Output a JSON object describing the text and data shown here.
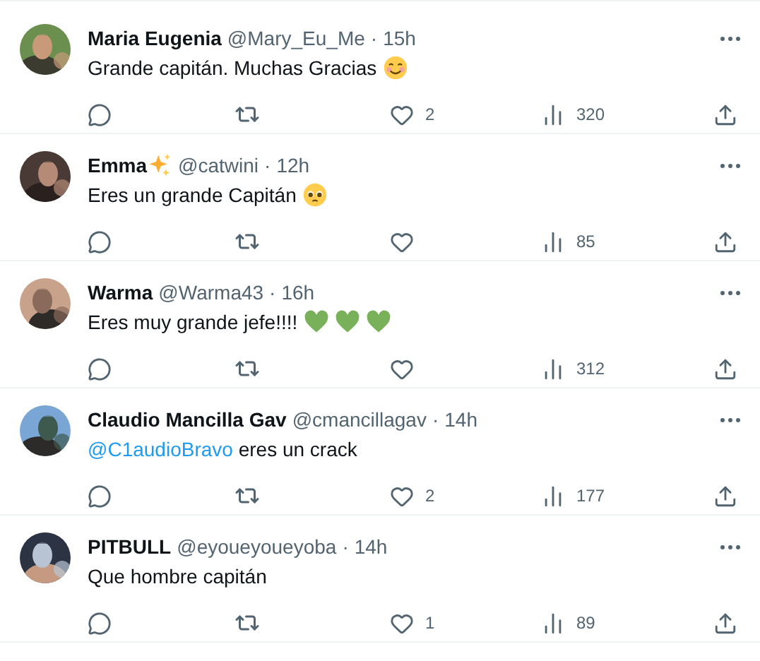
{
  "replies": [
    {
      "name": "Maria Eugenia",
      "handle": "@Mary_Eu_Me",
      "separator": "·",
      "time": "15h",
      "text": "Grande capitán. Muchas Gracias",
      "emojis": [
        {
          "kind": "smiling"
        }
      ],
      "likes": "2",
      "views": "320"
    },
    {
      "name": "Emma",
      "name_emoji": {
        "kind": "sparkles"
      },
      "handle": "@catwini",
      "separator": "·",
      "time": "12h",
      "text": "Eres un grande Capitán",
      "emojis": [
        {
          "kind": "pleading"
        }
      ],
      "views": "85"
    },
    {
      "name": "Warma",
      "handle": "@Warma43",
      "separator": "·",
      "time": "16h",
      "text": "Eres muy grande jefe!!!!",
      "emojis": [
        {
          "kind": "green-heart"
        },
        {
          "kind": "green-heart"
        },
        {
          "kind": "green-heart"
        }
      ],
      "views": "312"
    },
    {
      "name": "Claudio Mancilla Gav",
      "handle": "@cmancillagav",
      "separator": "·",
      "time": "14h",
      "mention": "@C1audioBravo",
      "text": "eres un crack",
      "likes": "2",
      "views": "177"
    },
    {
      "name": "PITBULL",
      "handle": "@eyoueyoueyoba",
      "separator": "·",
      "time": "14h",
      "text": "Que hombre capitán",
      "likes": "1",
      "views": "89"
    }
  ]
}
